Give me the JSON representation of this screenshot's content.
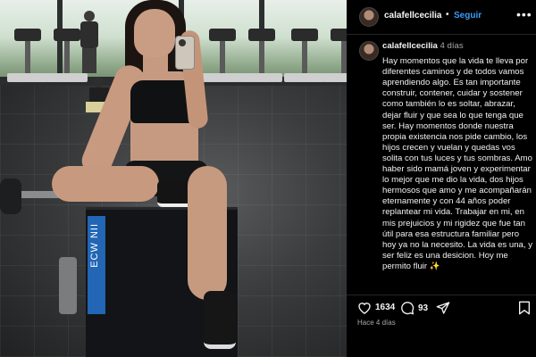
{
  "header": {
    "username": "calafellcecilia",
    "separator": "•",
    "follow_label": "Seguir",
    "more_icon": "more-horizontal-icon"
  },
  "caption": {
    "username": "calafellcecilia",
    "time": "4 días",
    "text": "Hay momentos que la vida te lleva por diferentes caminos y de todos vamos aprendiendo algo. Es tan importante construir, contener, cuidar y sostener como también lo es soltar, abrazar, dejar fluir y que sea lo que tenga que ser. Hay momentos donde nuestra propia existencia nos pide cambio, los hijos crecen y vuelan y quedas vos solita con tus luces y tus sombras. Amo haber sido mamá joven y experimentar lo mejor que me dio la vida, dos hijos hermosos que amo y me acompañarán eternamente y con 44 años poder replantear mi vida. Trabajar en mi, en mis prejuicios y mi rigidez que fue tan útil para esa estructura familiar pero hoy ya no la necesito. La vida es una, y ser feliz es una desicion. Hoy me permito fluir ✨"
  },
  "actions": {
    "like_count": "1634",
    "comment_count": "93",
    "icons": [
      "heart-icon",
      "comment-icon",
      "share-icon",
      "bookmark-icon"
    ]
  },
  "timestamp": "Hace 4 días",
  "photo": {
    "box_text": "ECW NII"
  },
  "colors": {
    "background": "#000000",
    "follow_blue": "#3b9bf4",
    "muted_text": "#a8a8a8"
  }
}
